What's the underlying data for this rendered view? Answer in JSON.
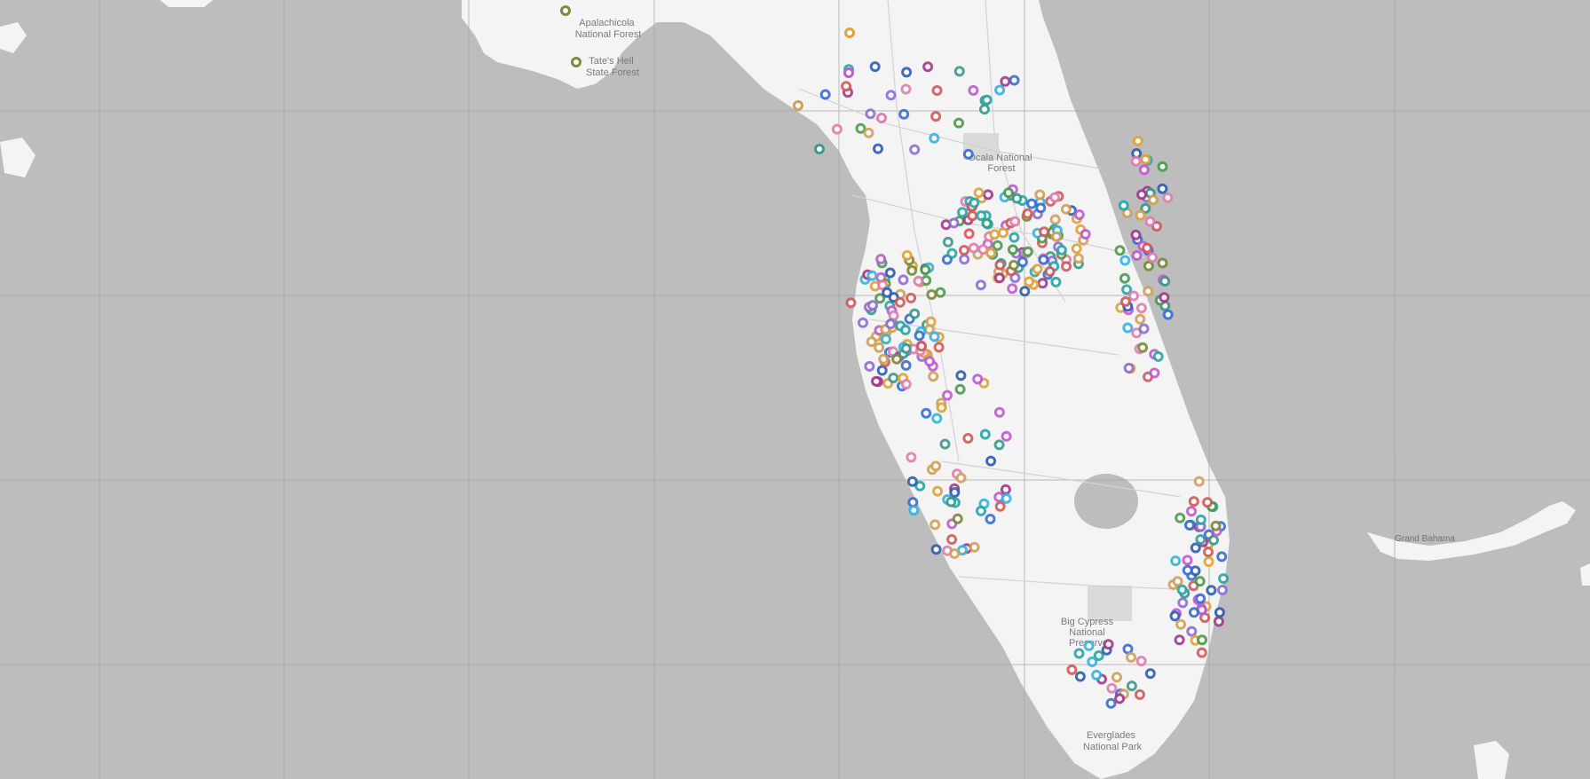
{
  "map": {
    "colors": {
      "water": "#bdbdbd",
      "land": "#f4f4f4",
      "grid": "#a9a9a9",
      "roads": "#d3d3d3",
      "parks": "#cfcfcf"
    },
    "labels": [
      {
        "id": "apalachicola",
        "lines": [
          "Apalachicola",
          "National Forest"
        ]
      },
      {
        "id": "tates-hell",
        "lines": [
          "Tate's Hell",
          "State Forest"
        ]
      },
      {
        "id": "ocala",
        "lines": [
          "Ocala National",
          "Forest"
        ]
      },
      {
        "id": "big-cypress",
        "lines": [
          "Big Cypress",
          "National",
          "Preserve"
        ]
      },
      {
        "id": "everglades",
        "lines": [
          "Everglades",
          "National Park"
        ]
      },
      {
        "id": "grand-bahama",
        "lines": [
          "Grand Bahama"
        ]
      }
    ],
    "marker_palette": [
      "#e0a33a",
      "#3a6fd1",
      "#c05bd0",
      "#2aa6a6",
      "#d05b5b",
      "#7a8b3b",
      "#e07fb0",
      "#8f6fd6",
      "#36b3e0",
      "#4d9a4d",
      "#d0a05b",
      "#2f5fb0",
      "#a33a8a",
      "#3a9a8a"
    ],
    "marker_count": 420
  }
}
